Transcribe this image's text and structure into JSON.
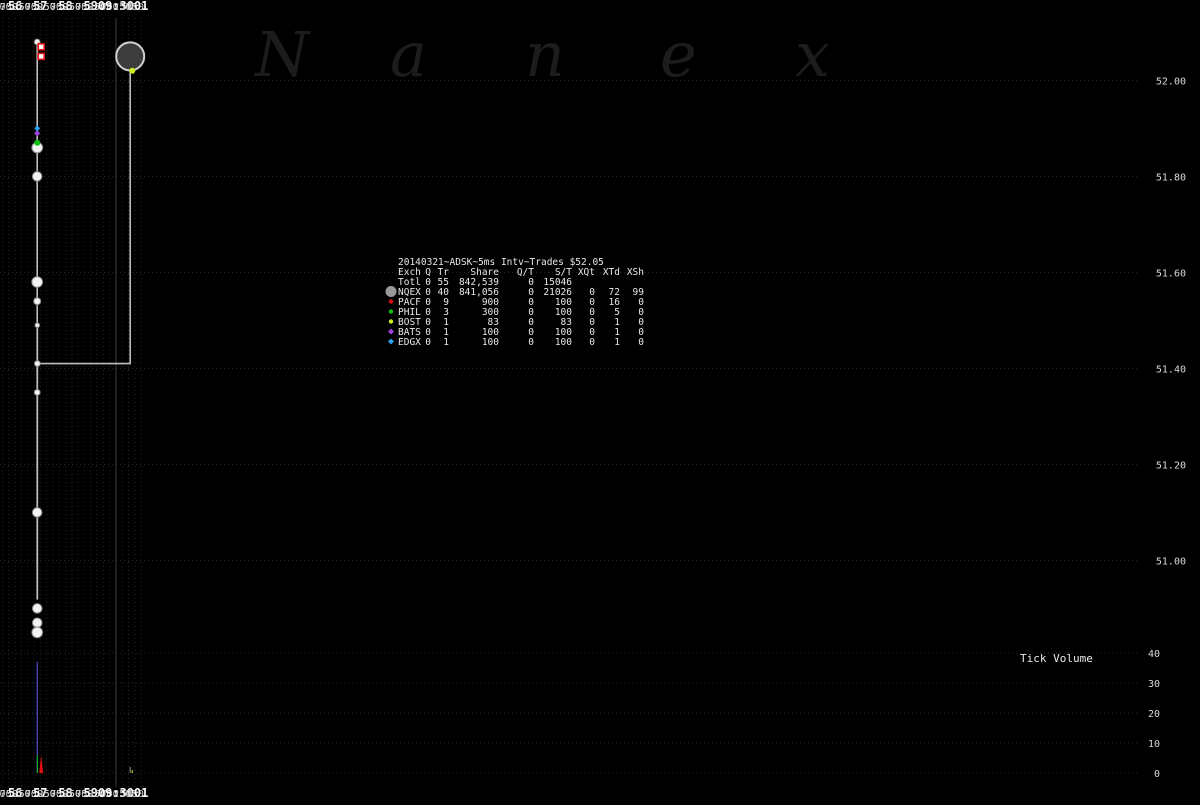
{
  "watermark": [
    "N",
    "a",
    "n",
    "e",
    "x"
  ],
  "chart_data": {
    "type": "scatter",
    "title": "20140321~ADSK~5ms Intv~Trades $52.05",
    "price_axis": {
      "ticks": [
        "52.00",
        "51.80",
        "51.60",
        "51.40",
        "51.20",
        "51.00"
      ],
      "tick_values": [
        52.0,
        51.8,
        51.6,
        51.4,
        51.2,
        51.0
      ],
      "range": [
        50.83,
        52.13
      ]
    },
    "volume_axis": {
      "title": "Tick Volume",
      "ticks": [
        "40",
        "30",
        "20",
        "10",
        "0"
      ],
      "tick_values": [
        40,
        30,
        20,
        10,
        0
      ],
      "range": [
        0,
        40
      ]
    },
    "x_axis": {
      "unit": "ms",
      "range": [
        456400,
        501640
      ],
      "ticks": [
        {
          "label": "500",
          "t": 456500,
          "bold": false
        },
        {
          "label": "750",
          "t": 456750,
          "bold": false
        },
        {
          "label": "56",
          "t": 457000,
          "bold": true
        },
        {
          "label": "250",
          "t": 457250,
          "bold": false
        },
        {
          "label": "500",
          "t": 457500,
          "bold": false
        },
        {
          "label": "750",
          "t": 457750,
          "bold": false
        },
        {
          "label": "57",
          "t": 458000,
          "bold": true
        },
        {
          "label": "250",
          "t": 458250,
          "bold": false
        },
        {
          "label": "500",
          "t": 458500,
          "bold": false
        },
        {
          "label": "750",
          "t": 458750,
          "bold": false
        },
        {
          "label": "58",
          "t": 459000,
          "bold": true
        },
        {
          "label": "250",
          "t": 459250,
          "bold": false
        },
        {
          "label": "500",
          "t": 459500,
          "bold": false
        },
        {
          "label": "750",
          "t": 459750,
          "bold": false
        },
        {
          "label": "59",
          "t": 460000,
          "bold": true
        },
        {
          "label": "250",
          "t": 460250,
          "bold": false
        },
        {
          "label": "500",
          "t": 460500,
          "bold": false
        },
        {
          "label": "750",
          "t": 460750,
          "bold": false
        },
        {
          "label": "09:30",
          "t": 461000,
          "bold": true
        },
        {
          "label": "250",
          "t": 461250,
          "bold": false
        },
        {
          "label": "500",
          "t": 461500,
          "bold": false
        },
        {
          "label": "750",
          "t": 461750,
          "bold": false
        },
        {
          "label": "01",
          "t": 462000,
          "bold": true
        }
      ]
    },
    "legend": {
      "header": [
        "Exch",
        "Q",
        "Tr",
        "Share",
        "Q/T",
        "S/T",
        "XQt",
        "XTd",
        "XSh"
      ],
      "rows": [
        {
          "exch": "Totl",
          "q": "0",
          "tr": "55",
          "share": "842,539",
          "qt": "0",
          "st": "15046",
          "xqt": "",
          "xtd": "",
          "xsh": "",
          "color": "",
          "marker": "none"
        },
        {
          "exch": "NQEX",
          "q": "0",
          "tr": "40",
          "share": "841,056",
          "qt": "0",
          "st": "21026",
          "xqt": "0",
          "xtd": "72",
          "xsh": "99",
          "color": "#9a9a9a",
          "marker": "big-circle"
        },
        {
          "exch": "PACF",
          "q": "0",
          "tr": "9",
          "share": "900",
          "qt": "0",
          "st": "100",
          "xqt": "0",
          "xtd": "16",
          "xsh": "0",
          "color": "#e01010",
          "marker": "circle"
        },
        {
          "exch": "PHIL",
          "q": "0",
          "tr": "3",
          "share": "300",
          "qt": "0",
          "st": "100",
          "xqt": "0",
          "xtd": "5",
          "xsh": "0",
          "color": "#10c010",
          "marker": "circle"
        },
        {
          "exch": "BOST",
          "q": "0",
          "tr": "1",
          "share": "83",
          "qt": "0",
          "st": "83",
          "xqt": "0",
          "xtd": "1",
          "xsh": "0",
          "color": "#c8f020",
          "marker": "circle"
        },
        {
          "exch": "BATS",
          "q": "0",
          "tr": "1",
          "share": "100",
          "qt": "0",
          "st": "100",
          "xqt": "0",
          "xtd": "1",
          "xsh": "0",
          "color": "#a040e0",
          "marker": "diamond"
        },
        {
          "exch": "EDGX",
          "q": "0",
          "tr": "1",
          "share": "100",
          "qt": "0",
          "st": "100",
          "xqt": "0",
          "xtd": "1",
          "xsh": "0",
          "color": "#30a0f0",
          "marker": "diamond"
        }
      ]
    },
    "trade_line": [
      {
        "t": 457875,
        "p": 52.08
      },
      {
        "t": 457875,
        "p": 50.92
      },
      {
        "t": 457883,
        "p": 50.92
      },
      {
        "t": 457883,
        "p": 51.49
      },
      {
        "t": 457885,
        "p": 51.41
      },
      {
        "t": 461567,
        "p": 51.41
      },
      {
        "t": 461567,
        "p": 52.05
      }
    ],
    "trades": [
      {
        "exch": "NQEX",
        "t": 457875,
        "p": 52.08,
        "size": 3
      },
      {
        "exch": "NQEX",
        "t": 457878,
        "p": 51.86,
        "size": 7
      },
      {
        "exch": "NQEX",
        "t": 457875,
        "p": 51.8,
        "size": 6
      },
      {
        "exch": "NQEX",
        "t": 457875,
        "p": 51.58,
        "size": 7
      },
      {
        "exch": "NQEX",
        "t": 457876,
        "p": 51.54,
        "size": 4
      },
      {
        "exch": "NQEX",
        "t": 457880,
        "p": 51.49,
        "size": 2
      },
      {
        "exch": "NQEX",
        "t": 457884,
        "p": 51.41,
        "size": 3
      },
      {
        "exch": "NQEX",
        "t": 457877,
        "p": 51.35,
        "size": 3
      },
      {
        "exch": "NQEX",
        "t": 457876,
        "p": 51.1,
        "size": 6
      },
      {
        "exch": "NQEX",
        "t": 457878,
        "p": 50.9,
        "size": 6
      },
      {
        "exch": "NQEX",
        "t": 457878,
        "p": 50.87,
        "size": 6
      },
      {
        "exch": "NQEX",
        "t": 457876,
        "p": 50.85,
        "size": 7
      },
      {
        "exch": "NQEX",
        "t": 461567,
        "p": 52.05,
        "size": 14
      },
      {
        "exch": "PHIL",
        "t": 457882,
        "p": 51.87,
        "size": 3
      },
      {
        "exch": "BATS",
        "t": 457875,
        "p": 51.89,
        "size": 3
      },
      {
        "exch": "EDGX",
        "t": 457876,
        "p": 51.9,
        "size": 3
      },
      {
        "exch": "BOST",
        "t": 461648,
        "p": 52.02,
        "size": 3
      }
    ],
    "pacf_markers": [
      {
        "t": 458035,
        "p": 52.07
      },
      {
        "t": 458035,
        "p": 52.05
      }
    ],
    "tick_volume": [
      {
        "exch": "NQEX",
        "t": 457876,
        "v": 37,
        "color": "#6060ff"
      },
      {
        "exch": "PHIL",
        "t": 457883,
        "v": 6,
        "color": "#10c010"
      },
      {
        "exch": "PACF",
        "t": 458035,
        "v": 6,
        "color": "#e01010"
      },
      {
        "exch": "NQEX",
        "t": 461567,
        "v": 2,
        "color": "#9a9a9a"
      },
      {
        "exch": "BOST",
        "t": 461648,
        "v": 1,
        "color": "#c8f020"
      }
    ],
    "grid": true
  }
}
